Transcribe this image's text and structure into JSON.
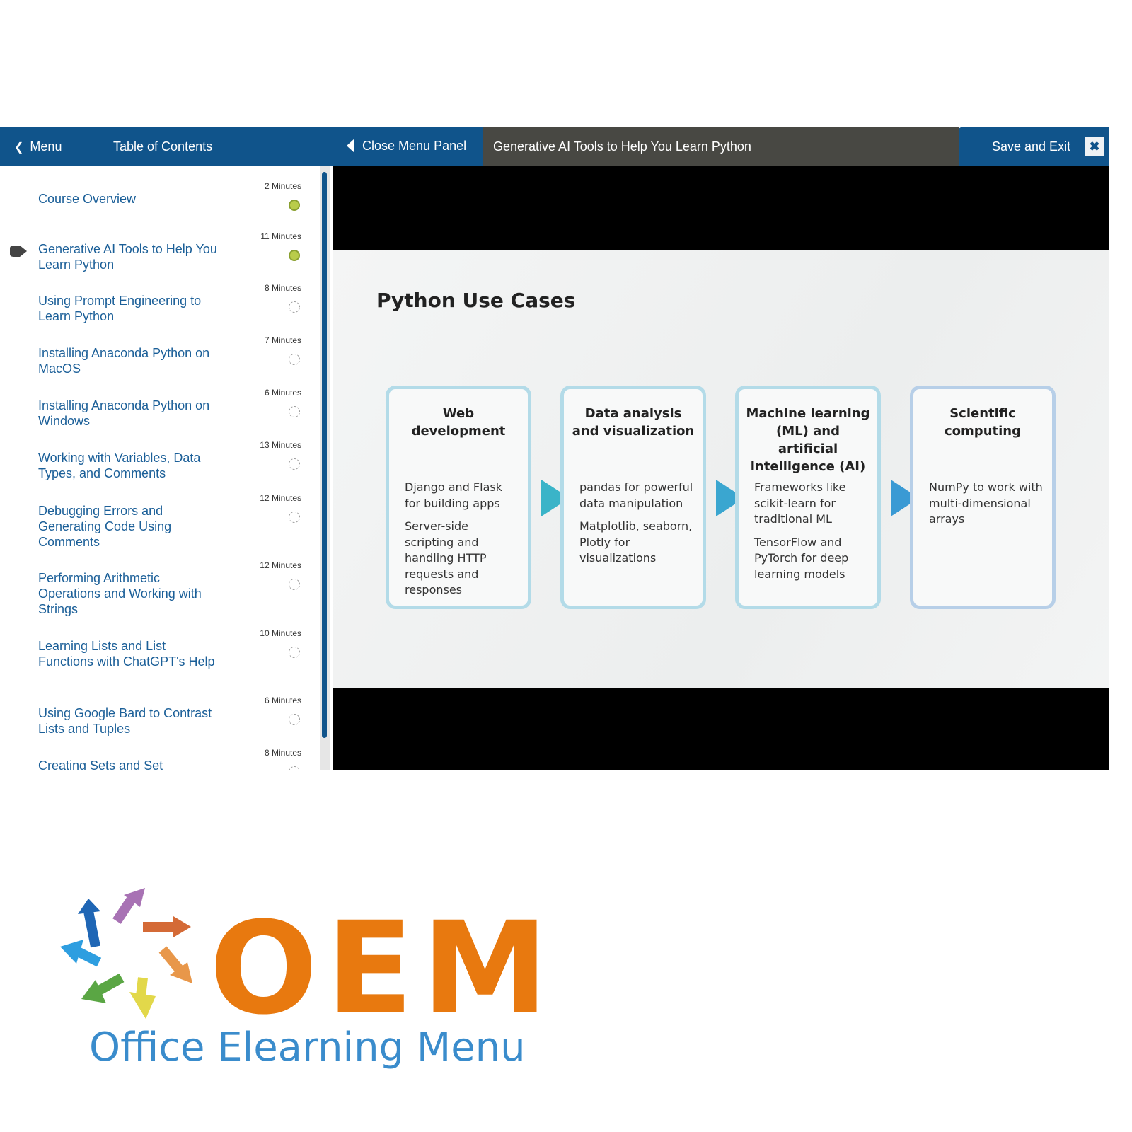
{
  "header": {
    "menu_label": "Menu",
    "toc_label": "Table of Contents",
    "close_panel_label": "Close Menu Panel",
    "lesson_title": "Generative AI Tools to Help You Learn Python",
    "save_exit_label": "Save and Exit"
  },
  "sidebar": {
    "items": [
      {
        "title": "Course Overview",
        "duration": "2 Minutes",
        "status": "complete"
      },
      {
        "title": "Generative AI Tools to Help You Learn Python",
        "duration": "11 Minutes",
        "status": "complete",
        "current": true
      },
      {
        "title": "Using Prompt Engineering to Learn Python",
        "duration": "8 Minutes",
        "status": "not-started"
      },
      {
        "title": "Installing Anaconda Python on MacOS",
        "duration": "7 Minutes",
        "status": "not-started"
      },
      {
        "title": "Installing Anaconda Python on Windows",
        "duration": "6 Minutes",
        "status": "not-started"
      },
      {
        "title": "Working with Variables, Data Types, and Comments",
        "duration": "13 Minutes",
        "status": "not-started"
      },
      {
        "title": "Debugging Errors and Generating Code Using Comments",
        "duration": "12 Minutes",
        "status": "not-started"
      },
      {
        "title": "Performing Arithmetic Operations and Working with Strings",
        "duration": "12 Minutes",
        "status": "not-started"
      },
      {
        "title": "Learning Lists and List Functions with ChatGPT's Help",
        "duration": "10 Minutes",
        "status": "not-started"
      },
      {
        "title": "Using Google Bard to Contrast Lists and Tuples",
        "duration": "6 Minutes",
        "status": "not-started"
      },
      {
        "title": "Creating Sets and Set Operations with ChatGPT",
        "duration": "8 Minutes",
        "status": "not-started"
      }
    ]
  },
  "slide": {
    "title": "Python Use Cases",
    "cards": [
      {
        "heading": "Web development",
        "bullets": [
          "Django and Flask for building apps",
          "Server-side scripting and handling HTTP requests and responses"
        ]
      },
      {
        "heading": "Data analysis and visualization",
        "bullets": [
          "pandas for powerful data manipulation",
          "Matplotlib, seaborn, Plotly for visualizations"
        ]
      },
      {
        "heading": "Machine learning (ML) and artificial intelligence (AI)",
        "bullets": [
          "Frameworks like scikit-learn for traditional ML",
          "TensorFlow and PyTorch for deep learning models"
        ]
      },
      {
        "heading": "Scientific computing",
        "bullets": [
          "NumPy to work with multi-dimensional arrays"
        ]
      }
    ]
  },
  "logo": {
    "mark": "OEM",
    "name": "Office Elearning Menu"
  },
  "colors": {
    "header_blue": "#10548b",
    "header_gray": "#484843",
    "complete_green": "#b9cc4a",
    "logo_orange": "#e8790f",
    "logo_blue": "#3a8ccc"
  }
}
